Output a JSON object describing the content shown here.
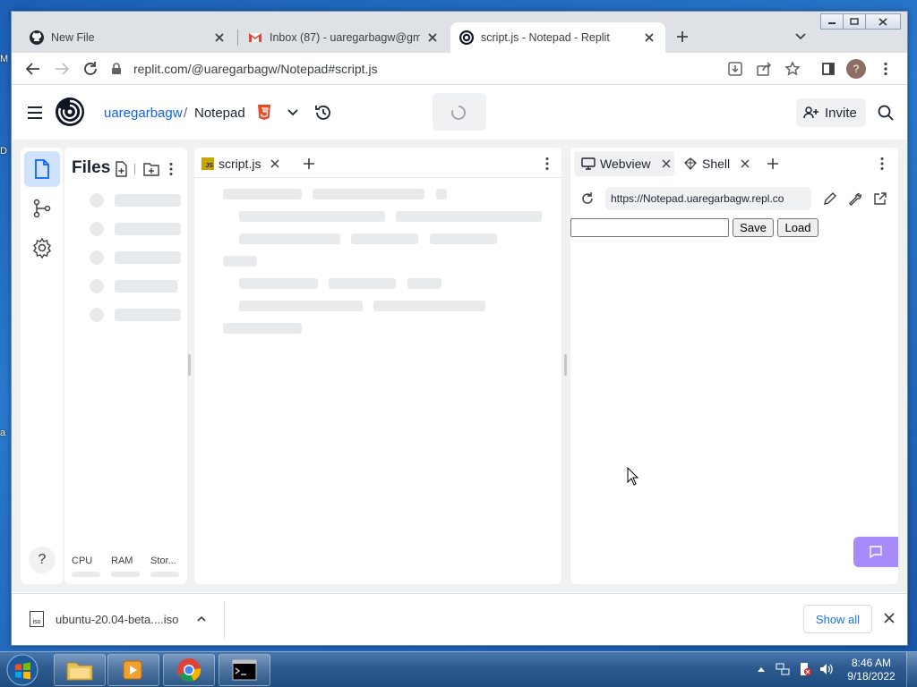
{
  "browser": {
    "tabs": [
      {
        "title": "New File",
        "icon": "github-icon"
      },
      {
        "title": "Inbox (87) - uaregarbagw@gmail",
        "icon": "gmail-icon"
      },
      {
        "title": "script.js - Notepad - Replit",
        "icon": "replit-icon",
        "active": true
      }
    ],
    "url": "replit.com/@uaregarbagw/Notepad#script.js",
    "profile_initial": "?"
  },
  "replit": {
    "user": "uaregarbagw",
    "separator": "/",
    "repl_name": "Notepad",
    "invite_label": "Invite",
    "files_title": "Files",
    "resources": [
      "CPU",
      "RAM",
      "Stor..."
    ],
    "editor_tab": "script.js",
    "editor_tab_badge": "JS",
    "webview_tab": "Webview",
    "shell_tab": "Shell",
    "webview_url": "https://Notepad.uaregarbagw.repl.co",
    "webview_input_value": "",
    "save_label": "Save",
    "load_label": "Load",
    "help_label": "?"
  },
  "downloads": {
    "filename": "ubuntu-20.04-beta....iso",
    "file_badge": "iso",
    "show_all": "Show all"
  },
  "taskbar": {
    "time": "8:46 AM",
    "date": "9/18/2022"
  },
  "colors": {
    "replit_link": "#0f62fe",
    "chat_button": "#a78bfa",
    "html_badge": "#e34c26",
    "js_badge": "#c9a400"
  }
}
